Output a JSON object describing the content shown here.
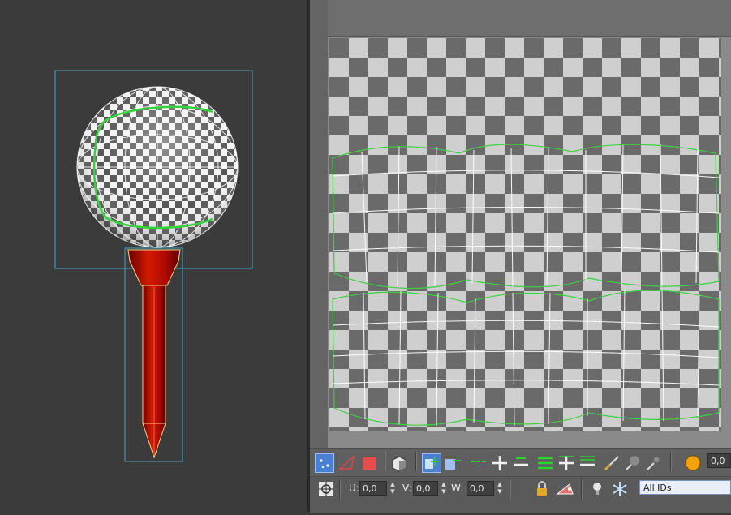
{
  "toolbar_bottom": {
    "u_label": "U:",
    "v_label": "V:",
    "w_label": "W:",
    "u_value": "0,0",
    "v_value": "0,0",
    "w_value": "0,0",
    "id_filter": "All IDs"
  },
  "toolbar_top": {
    "numeric_value": "0,0"
  },
  "icons": {
    "vertex_mode": "vertex-select-icon",
    "edge_mode": "edge-select-icon",
    "face_mode": "face-select-icon",
    "element_mode": "element-select-icon"
  }
}
